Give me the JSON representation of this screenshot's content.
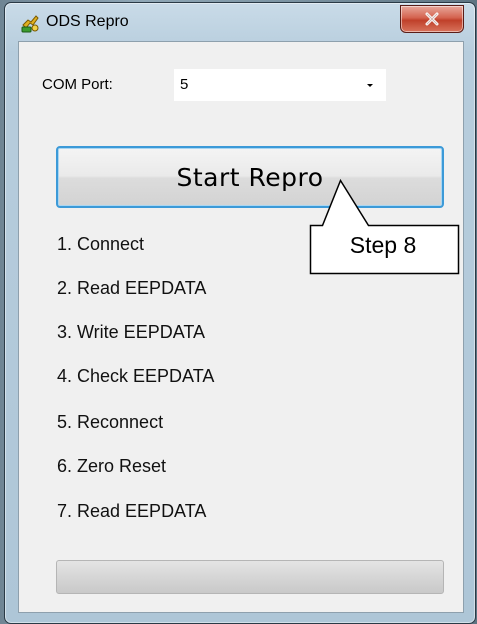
{
  "window": {
    "title": "ODS Repro",
    "close_glyph": "X",
    "icon": "gold-app-icon"
  },
  "com_port": {
    "label": "COM Port:",
    "value": "5",
    "dropdown_icon": "chevron-down-icon"
  },
  "start_button": {
    "label": "Start Repro"
  },
  "steps": [
    "1. Connect",
    "2. Read EEPDATA",
    "3. Write EEPDATA",
    "4. Check EEPDATA",
    "5. Reconnect",
    "6. Zero Reset",
    "7. Read EEPDATA"
  ],
  "progress": {
    "value": 0
  },
  "callout": {
    "text": "Step 8"
  },
  "colors": {
    "focus_border": "#3c9ad8",
    "close_button": "#c0402a",
    "client_background": "#f0f0f0"
  }
}
